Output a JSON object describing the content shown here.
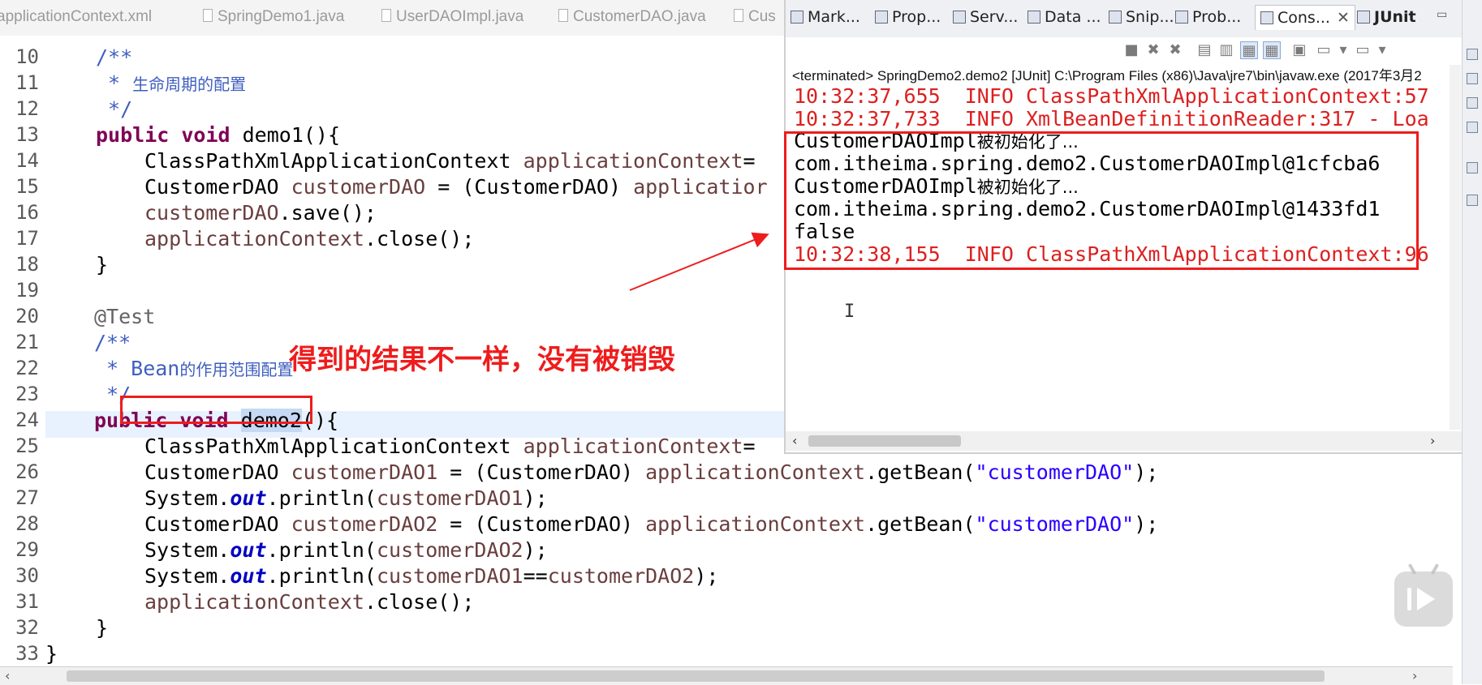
{
  "editor_tabs": [
    {
      "label": "applicationContext.xml"
    },
    {
      "label": "SpringDemo1.java"
    },
    {
      "label": "UserDAOImpl.java"
    },
    {
      "label": "CustomerDAO.java"
    },
    {
      "label": "Cus"
    }
  ],
  "line_numbers": [
    "10",
    "11",
    "12",
    "13",
    "14",
    "15",
    "16",
    "17",
    "18",
    "19",
    "20",
    "21",
    "22",
    "23",
    "24",
    "25",
    "26",
    "27",
    "28",
    "29",
    "30",
    "31",
    "32",
    "33"
  ],
  "code": {
    "l10": "/**",
    "l11_prefix": " * ",
    "l11_text": "生命周期的配置",
    "l12": " */",
    "l13_kw": "public void",
    "l13_rest": " demo1(){",
    "l14_a": "ClassPathXmlApplicationContext ",
    "l14_b": "applicationContext",
    "l14_c": "=",
    "l15_a": "CustomerDAO ",
    "l15_b": "customerDAO",
    "l15_c": " = (CustomerDAO) ",
    "l15_d": "applicatior",
    "l16_a": "customerDAO",
    "l16_b": ".save();",
    "l17_a": "applicationContext",
    "l17_b": ".close();",
    "l18": "}",
    "l20": "@Test",
    "l21": "/**",
    "l22_prefix": " * ",
    "l22_text": "Bean",
    "l22_cn": "的作用范围配置",
    "l23": " */",
    "l24_kw": "public void",
    "l24_sel": "demo2",
    "l24_rest": "(){",
    "l25_a": "ClassPathXmlApplicationContext ",
    "l25_b": "applicationContext",
    "l25_c": "=",
    "l26_a": "CustomerDAO ",
    "l26_b": "customerDAO1",
    "l26_c": " = (CustomerDAO) ",
    "l26_d": "applicationContext",
    "l26_e": ".getBean(",
    "l26_str": "\"customerDAO\"",
    "l26_f": ");",
    "l27_a": "System.",
    "l27_b": "out",
    "l27_c": ".println(",
    "l27_d": "customerDAO1",
    "l27_e": ");",
    "l28_a": "CustomerDAO ",
    "l28_b": "customerDAO2",
    "l28_c": " = (CustomerDAO) ",
    "l28_d": "applicationContext",
    "l28_e": ".getBean(",
    "l28_str": "\"customerDAO\"",
    "l28_f": ");",
    "l29_a": "System.",
    "l29_b": "out",
    "l29_c": ".println(",
    "l29_d": "customerDAO2",
    "l29_e": ");",
    "l30_a": "System.",
    "l30_b": "out",
    "l30_c": ".println(",
    "l30_d": "customerDAO1",
    "l30_e": "==",
    "l30_f": "customerDAO2",
    "l30_g": ");",
    "l31_a": "applicationContext",
    "l31_b": ".close();",
    "l32": "}",
    "l33": "}"
  },
  "annotation": "得到的结果不一样，没有被销毁",
  "console": {
    "view_tabs": [
      {
        "label": "Mark..."
      },
      {
        "label": "Prop..."
      },
      {
        "label": "Serv..."
      },
      {
        "label": "Data ..."
      },
      {
        "label": "Snip..."
      },
      {
        "label": "Prob..."
      },
      {
        "label": "Cons..."
      },
      {
        "label": "JUnit"
      }
    ],
    "description": "<terminated> SpringDemo2.demo2 [JUnit] C:\\Program Files (x86)\\Java\\jre7\\bin\\javaw.exe (2017年3月2",
    "lines": [
      {
        "text": "10:32:37,655  INFO ClassPathXmlApplicationContext:57"
      },
      {
        "text": "10:32:37,733  INFO XmlBeanDefinitionReader:317 - Loa"
      },
      {
        "text": "CustomerDAOImpl",
        "cn": "被初始化了..."
      },
      {
        "text": "com.itheima.spring.demo2.CustomerDAOImpl@1cfcba6"
      },
      {
        "text": "CustomerDAOImpl",
        "cn": "被初始化了..."
      },
      {
        "text": "com.itheima.spring.demo2.CustomerDAOImpl@1433fd1"
      },
      {
        "text": "false"
      },
      {
        "text": "10:32:38,155  INFO ClassPathXmlApplicationContext:96"
      }
    ]
  },
  "colors": {
    "keyword": "#7f0055",
    "comment": "#3f5fbf",
    "string": "#2a00ff",
    "annotation_red": "#ee1c1c",
    "console_info": "#dd1f1f"
  }
}
